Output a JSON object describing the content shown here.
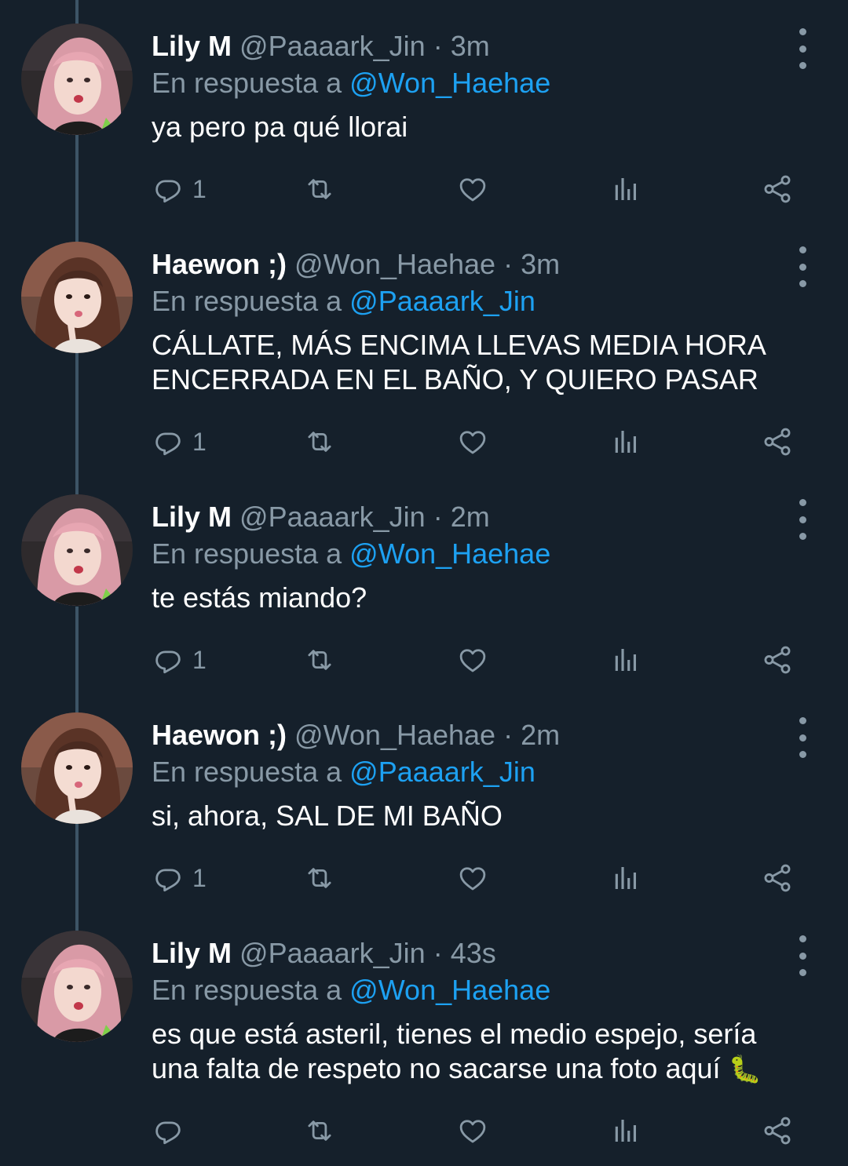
{
  "thread": {
    "reply_prefix": "En respuesta a",
    "separator": "·",
    "tweets": [
      {
        "name": "Lily M",
        "handle": "@Paaaark_Jin",
        "time": "3m",
        "reply_to": "@Won_Haehae",
        "text_lines": [
          "ya pero pa qué llorai"
        ],
        "reply_count": "1",
        "avatar_icon": "pink-hair-avatar"
      },
      {
        "name": "Haewon ;)",
        "handle": "@Won_Haehae",
        "time": "3m",
        "reply_to": "@Paaaark_Jin",
        "text_lines": [
          "CÁLLATE, MÁS ENCIMA LLEVAS MEDIA HORA",
          "ENCERRADA EN EL BAÑO, Y QUIERO PASAR"
        ],
        "reply_count": "1",
        "avatar_icon": "brown-hair-avatar"
      },
      {
        "name": "Lily M",
        "handle": "@Paaaark_Jin",
        "time": "2m",
        "reply_to": "@Won_Haehae",
        "text_lines": [
          "te estás miando?"
        ],
        "reply_count": "1",
        "avatar_icon": "pink-hair-avatar"
      },
      {
        "name": "Haewon ;)",
        "handle": "@Won_Haehae",
        "time": "2m",
        "reply_to": "@Paaaark_Jin",
        "text_lines": [
          "si, ahora, SAL DE MI BAÑO"
        ],
        "reply_count": "1",
        "avatar_icon": "brown-hair-avatar"
      },
      {
        "name": "Lily M",
        "handle": "@Paaaark_Jin",
        "time": "43s",
        "reply_to": "@Won_Haehae",
        "text_lines": [
          "es que está asteril, tienes el medio espejo, sería",
          "una falta de respeto no sacarse una foto aquí"
        ],
        "emoji": "🐛",
        "reply_count": "",
        "avatar_icon": "pink-hair-avatar"
      }
    ]
  },
  "colors": {
    "background": "#15202b",
    "text": "#ffffff",
    "muted": "#8899a6",
    "link": "#1da1f2",
    "thread_line": "#3d5466"
  },
  "action_icons": [
    "reply-icon",
    "retweet-icon",
    "like-icon",
    "analytics-icon",
    "share-icon"
  ]
}
